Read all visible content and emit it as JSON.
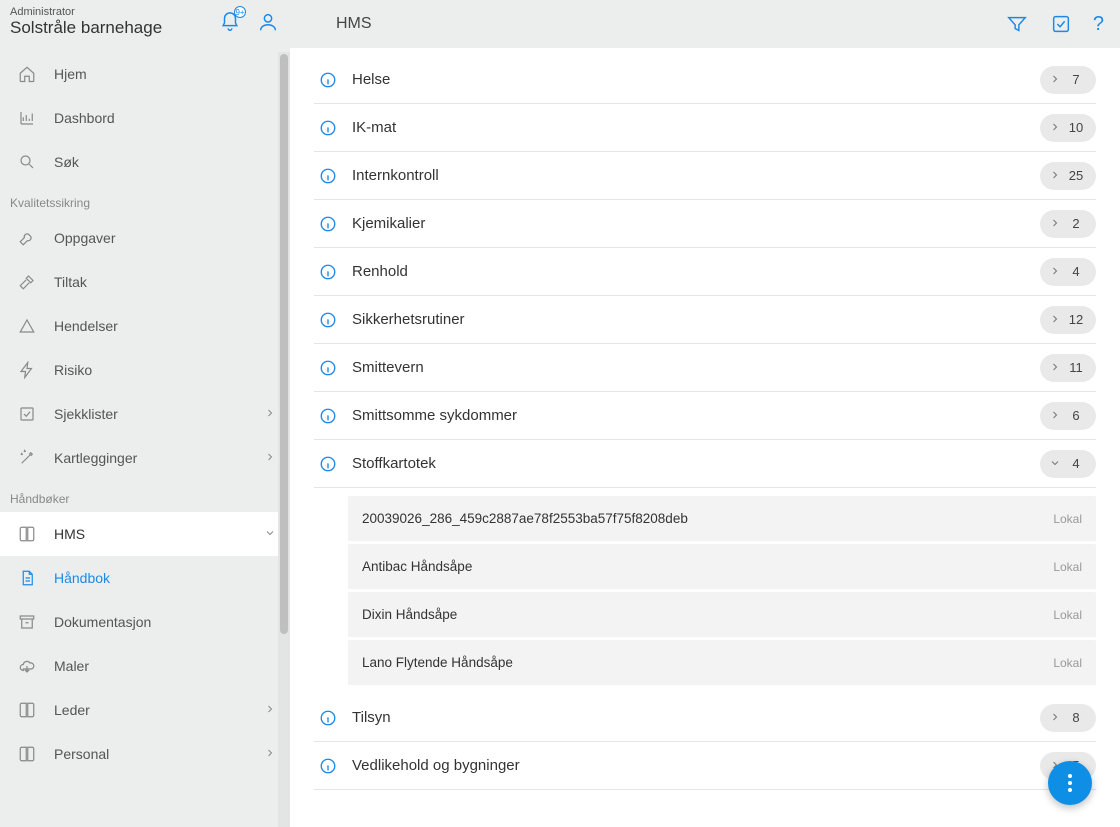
{
  "sidebar": {
    "role": "Administrator",
    "org": "Solstråle barnehage",
    "bellBadge": "9+",
    "groups": [
      {
        "header": null,
        "items": [
          {
            "icon": "home",
            "label": "Hjem",
            "chevron": false
          },
          {
            "icon": "chart",
            "label": "Dashbord",
            "chevron": false
          },
          {
            "icon": "search",
            "label": "Søk",
            "chevron": false
          }
        ]
      },
      {
        "header": "Kvalitetssikring",
        "items": [
          {
            "icon": "wrench",
            "label": "Oppgaver",
            "chevron": false
          },
          {
            "icon": "hammer",
            "label": "Tiltak",
            "chevron": false
          },
          {
            "icon": "triangle",
            "label": "Hendelser",
            "chevron": false
          },
          {
            "icon": "bolt",
            "label": "Risiko",
            "chevron": false
          },
          {
            "icon": "check",
            "label": "Sjekklister",
            "chevron": true
          },
          {
            "icon": "wand",
            "label": "Kartlegginger",
            "chevron": true
          }
        ]
      },
      {
        "header": "Håndbøker",
        "items": [
          {
            "icon": "book",
            "label": "HMS",
            "chevron": true,
            "selected": true,
            "open": true
          },
          {
            "icon": "doc",
            "label": "Håndbok",
            "active": true,
            "indent": true
          },
          {
            "icon": "archive",
            "label": "Dokumentasjon",
            "indent": true
          },
          {
            "icon": "cloud",
            "label": "Maler",
            "indent": true
          },
          {
            "icon": "book",
            "label": "Leder",
            "chevron": true
          },
          {
            "icon": "book",
            "label": "Personal",
            "chevron": true
          }
        ]
      }
    ]
  },
  "topbar": {
    "title": "HMS"
  },
  "categories": [
    {
      "label": "Helse",
      "count": "7",
      "expanded": false
    },
    {
      "label": "IK-mat",
      "count": "10",
      "expanded": false
    },
    {
      "label": "Internkontroll",
      "count": "25",
      "expanded": false
    },
    {
      "label": "Kjemikalier",
      "count": "2",
      "expanded": false
    },
    {
      "label": "Renhold",
      "count": "4",
      "expanded": false
    },
    {
      "label": "Sikkerhetsrutiner",
      "count": "12",
      "expanded": false
    },
    {
      "label": "Smittevern",
      "count": "11",
      "expanded": false
    },
    {
      "label": "Smittsomme sykdommer",
      "count": "6",
      "expanded": false
    },
    {
      "label": "Stoffkartotek",
      "count": "4",
      "expanded": true,
      "items": [
        {
          "label": "20039026_286_459c2887ae78f2553ba57f75f8208deb",
          "badge": "Lokal"
        },
        {
          "label": "Antibac Håndsåpe",
          "badge": "Lokal"
        },
        {
          "label": "Dixin Håndsåpe",
          "badge": "Lokal"
        },
        {
          "label": "Lano Flytende Håndsåpe",
          "badge": "Lokal"
        }
      ]
    },
    {
      "label": "Tilsyn",
      "count": "8",
      "expanded": false
    },
    {
      "label": "Vedlikehold og bygninger",
      "count": "5",
      "expanded": false
    }
  ]
}
